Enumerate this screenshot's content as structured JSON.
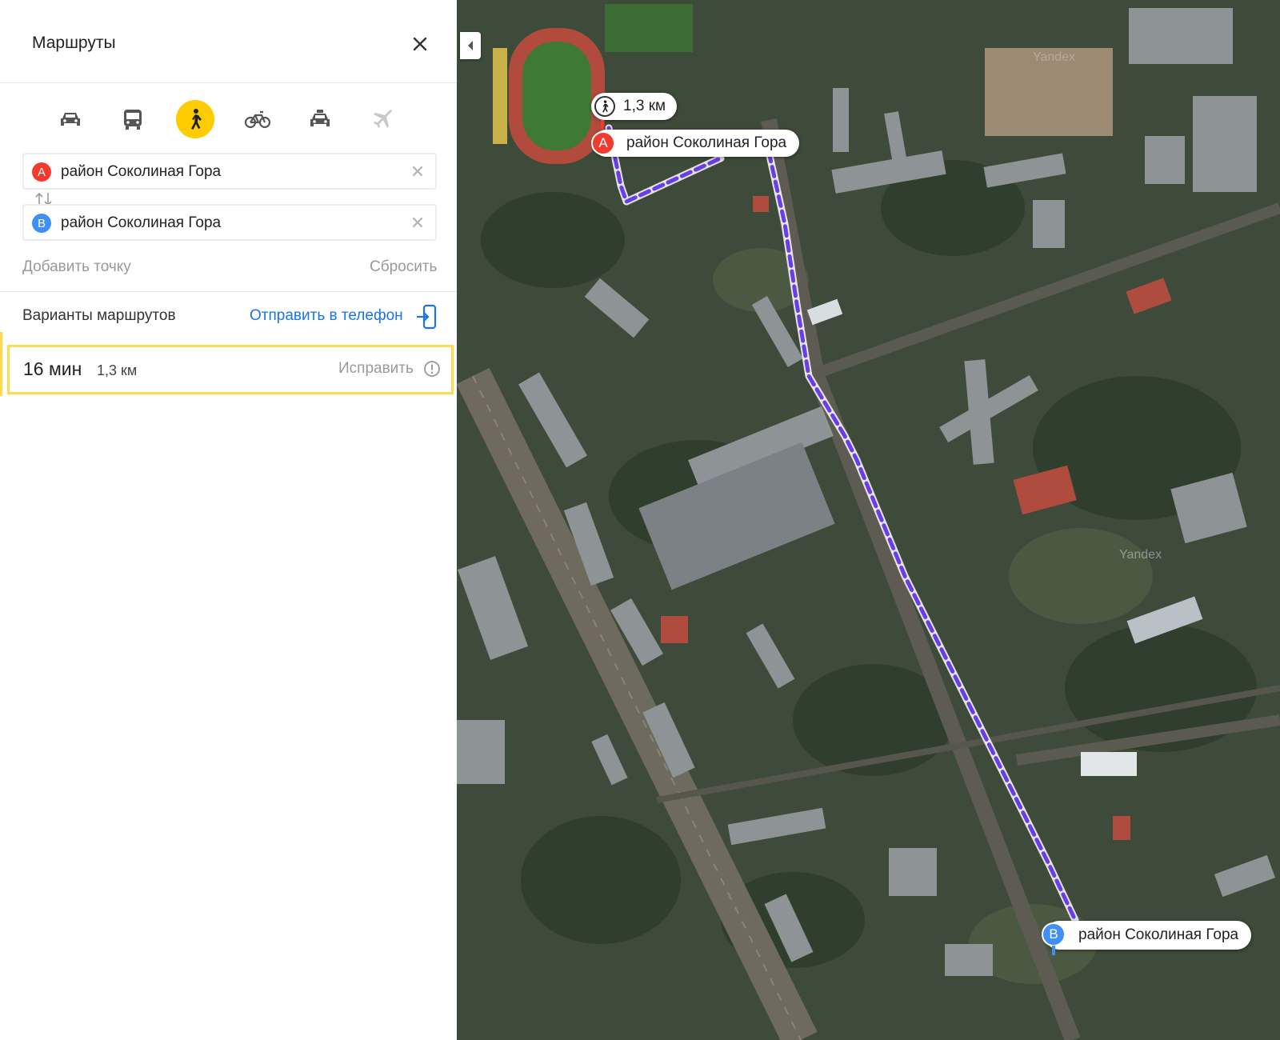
{
  "panel": {
    "title": "Маршруты",
    "modes": [
      {
        "name": "car",
        "icon": "car-icon",
        "active": false
      },
      {
        "name": "bus",
        "icon": "bus-icon",
        "active": false
      },
      {
        "name": "walk",
        "icon": "pedestrian-icon",
        "active": true
      },
      {
        "name": "bike",
        "icon": "bicycle-icon",
        "active": false
      },
      {
        "name": "taxi",
        "icon": "taxi-icon",
        "active": false
      },
      {
        "name": "plane",
        "icon": "plane-icon",
        "active": false
      }
    ],
    "point_a": {
      "letter": "A",
      "value": "район Соколиная Гора",
      "color": "#f33a2f"
    },
    "point_b": {
      "letter": "B",
      "value": "район Соколиная Гора",
      "color": "#3f8ff5"
    },
    "add_point": "Добавить точку",
    "reset": "Сбросить",
    "variants_label": "Варианты маршрутов",
    "send_to_phone": "Отправить в телефон",
    "route": {
      "time": "16 мин",
      "distance": "1,3 км",
      "fix": "Исправить"
    }
  },
  "map": {
    "route_color": "#6a3de8",
    "distance_badge": "1,3 км",
    "marker_a": {
      "letter": "A",
      "label": "район Соколиная Гора"
    },
    "marker_b": {
      "letter": "B",
      "label": "район Соколиная Гора"
    },
    "watermark": "Yandex"
  },
  "colors": {
    "accent": "#ffcc00",
    "link": "#1a73e8",
    "highlight_border": "#ffdb4d"
  }
}
